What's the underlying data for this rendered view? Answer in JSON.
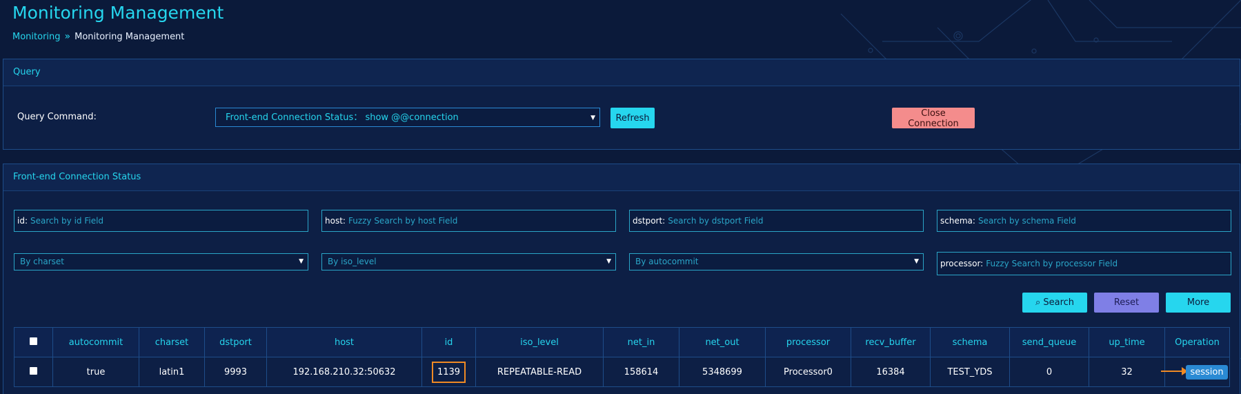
{
  "header": {
    "title": "Monitoring Management",
    "breadcrumb": {
      "parent": "Monitoring",
      "separator": "»",
      "current": "Monitoring Management"
    }
  },
  "query": {
    "panel_title": "Query",
    "command_label": "Query Command:",
    "command_value": "Front-end Connection Status： show @@connection",
    "refresh_label": "Refresh",
    "close_label": "Close Connection"
  },
  "connection": {
    "panel_title": "Front-end Connection Status",
    "filters": {
      "id": {
        "label": "id:",
        "placeholder": "Search by id Field"
      },
      "host": {
        "label": "host:",
        "placeholder": "Fuzzy Search by host Field"
      },
      "dstport": {
        "label": "dstport:",
        "placeholder": "Search by dstport Field"
      },
      "schema": {
        "label": "schema:",
        "placeholder": "Search by schema Field"
      },
      "charset": "By charset",
      "iso_level": "By iso_level",
      "autocommit": "By autocommit",
      "processor": {
        "label": "processor:",
        "placeholder": "Fuzzy Search by processor Field"
      }
    },
    "buttons": {
      "search": "Search",
      "reset": "Reset",
      "more": "More"
    },
    "columns": [
      "autocommit",
      "charset",
      "dstport",
      "host",
      "id",
      "iso_level",
      "net_in",
      "net_out",
      "processor",
      "recv_buffer",
      "schema",
      "send_queue",
      "up_time",
      "Operation"
    ],
    "rows": [
      {
        "autocommit": "true",
        "charset": "latin1",
        "dstport": "9993",
        "host": "192.168.210.32:50632",
        "id": "1139",
        "iso_level": "REPEATABLE-READ",
        "net_in": "158614",
        "net_out": "5348699",
        "processor": "Processor0",
        "recv_buffer": "16384",
        "schema": "TEST_YDS",
        "send_queue": "0",
        "up_time": "32",
        "operation": "session"
      }
    ]
  },
  "colors": {
    "accent": "#26d6ee",
    "background": "#0b1a3a",
    "danger": "#f48c8c",
    "highlight": "#f08a24"
  }
}
